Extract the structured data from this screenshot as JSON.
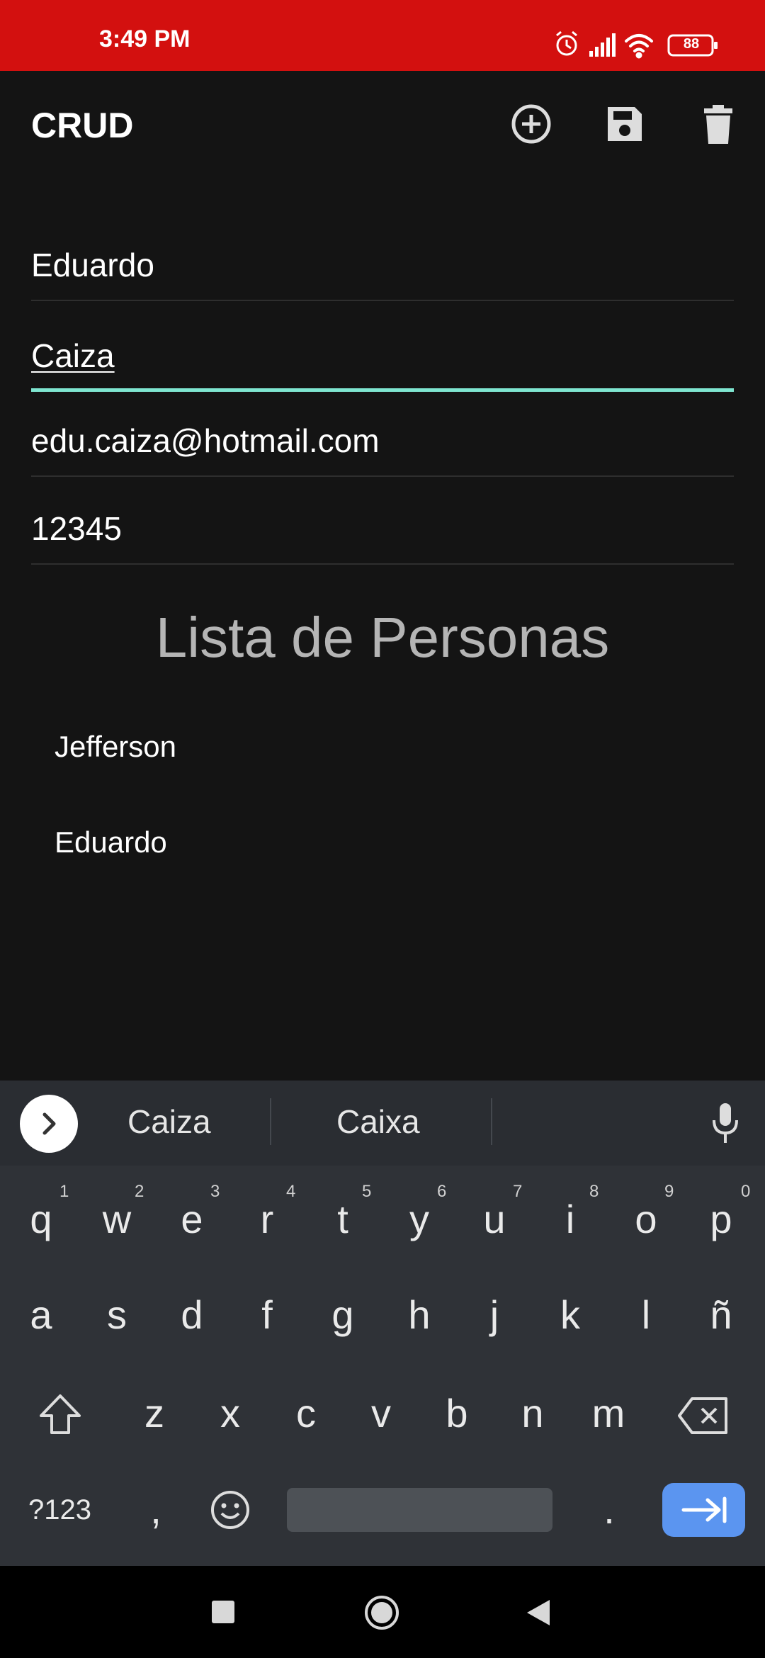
{
  "status_bar": {
    "time": "3:49 PM",
    "battery": "88"
  },
  "app_bar": {
    "title": "CRUD",
    "actions": [
      "add-circle-icon",
      "save-icon",
      "delete-icon"
    ]
  },
  "form": {
    "fields": [
      {
        "value": "Eduardo"
      },
      {
        "value": "Caiza"
      },
      {
        "value": "edu.caiza@hotmail.com"
      },
      {
        "value": "12345"
      }
    ]
  },
  "list": {
    "title": "Lista de Personas",
    "items": [
      "Jefferson",
      "Eduardo"
    ]
  },
  "keyboard": {
    "suggestions": [
      "Caiza",
      "Caixa"
    ],
    "row1": [
      "q",
      "w",
      "e",
      "r",
      "t",
      "y",
      "u",
      "i",
      "o",
      "p"
    ],
    "row1_hints": [
      "1",
      "2",
      "3",
      "4",
      "5",
      "6",
      "7",
      "8",
      "9",
      "0"
    ],
    "row2": [
      "a",
      "s",
      "d",
      "f",
      "g",
      "h",
      "j",
      "k",
      "l",
      "ñ"
    ],
    "row3": [
      "z",
      "x",
      "c",
      "v",
      "b",
      "n",
      "m"
    ],
    "symbols_key": "?123",
    "comma_key": ",",
    "period_key": "."
  },
  "colors": {
    "status_bar": "#d3100f",
    "background": "#141414",
    "active_underline": "#7fe6d1",
    "keyboard_bg": "#2f3237",
    "enter_key": "#5b95f0"
  }
}
